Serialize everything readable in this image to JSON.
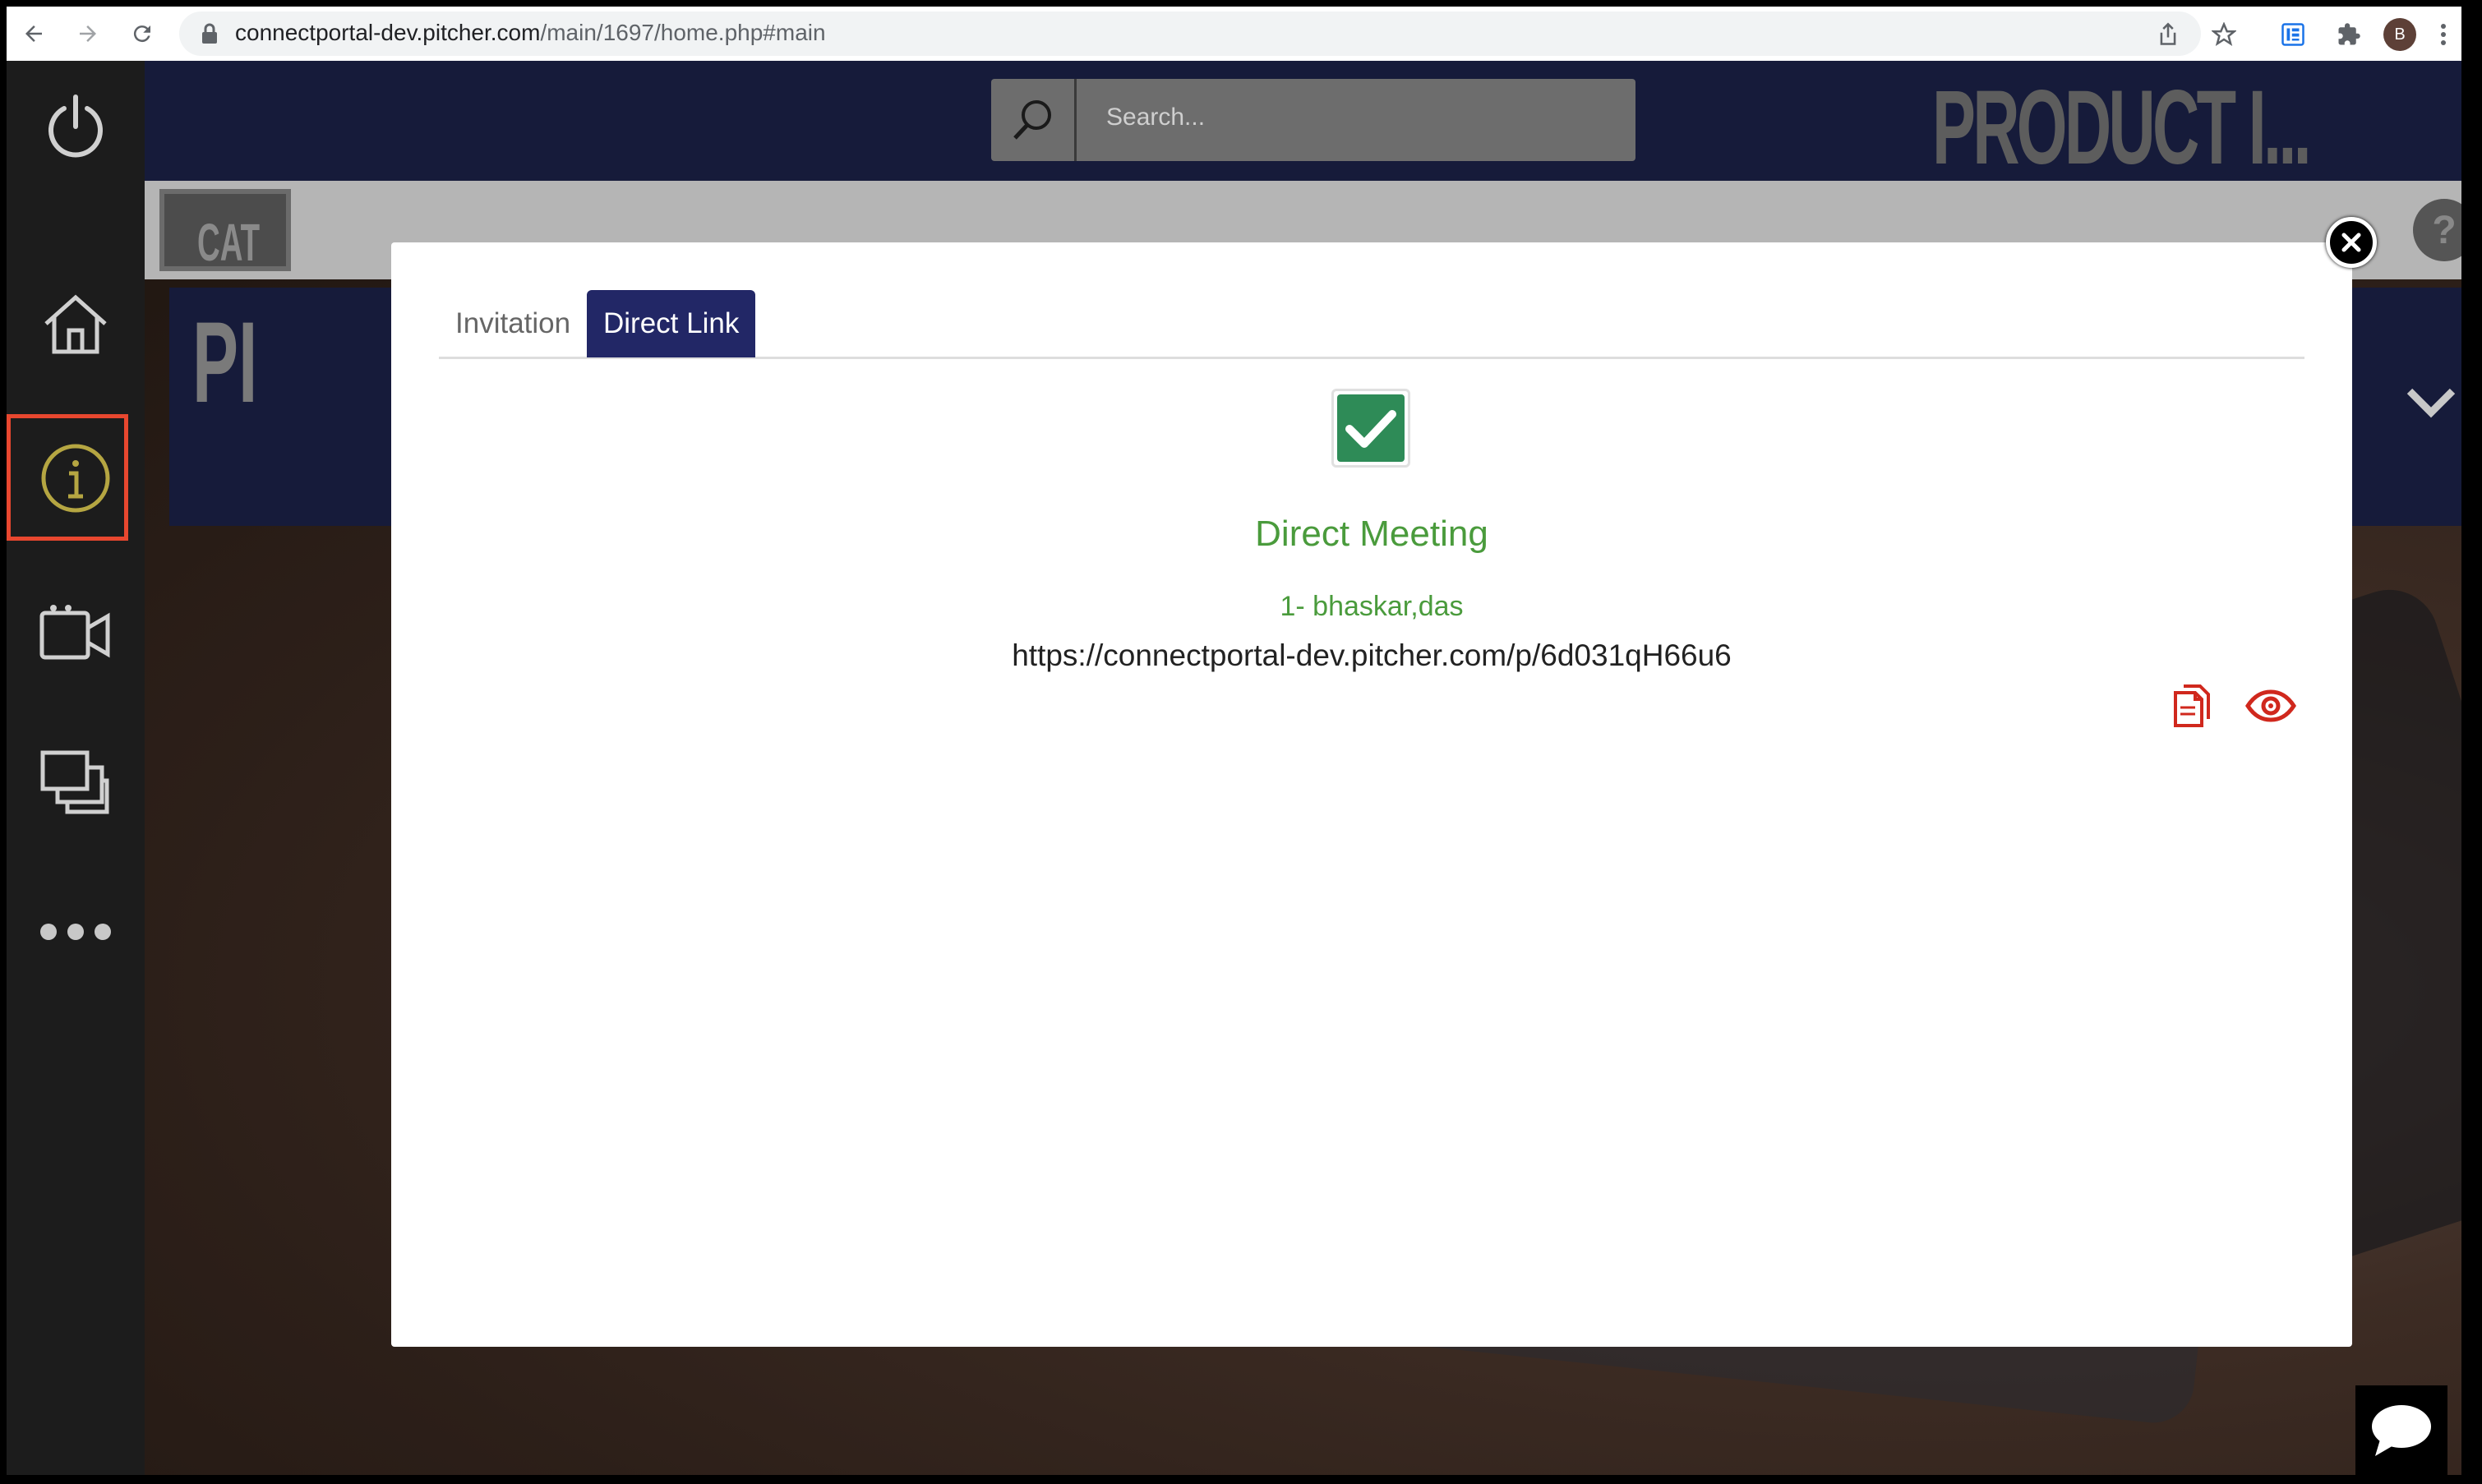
{
  "browser": {
    "url_domain": "connectportal-dev.pitcher.com",
    "url_path": "/main/1697/home.php#main",
    "profile_initial": "B"
  },
  "header": {
    "search_placeholder": "Search...",
    "title": "PRODUCT I..."
  },
  "background": {
    "category_text": "CAT",
    "panel_text": "PI",
    "help_label": "?"
  },
  "modal": {
    "tabs": [
      {
        "label": "Invitation",
        "active": false
      },
      {
        "label": "Direct Link",
        "active": true
      }
    ],
    "checked": true,
    "meeting_title": "Direct Meeting",
    "attendee": "1- bhaskar,das",
    "link": "https://connectportal-dev.pitcher.com/p/6d031qH66u6"
  },
  "colors": {
    "accent_tab": "#222766",
    "success_green": "#4a9b3c",
    "action_red": "#d0281d",
    "highlight_border": "#e8472f"
  },
  "sidebar": {
    "items": [
      "power-icon",
      "home-icon",
      "info-icon",
      "video-camera-icon",
      "slides-icon",
      "more-icon"
    ],
    "highlighted": "info-icon"
  }
}
